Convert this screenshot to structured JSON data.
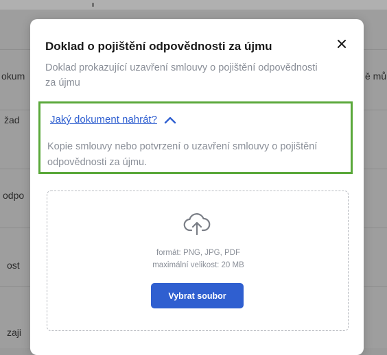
{
  "background": {
    "rows": [
      {
        "left": "okum",
        "right": "ě mů"
      },
      {
        "left": "žad"
      },
      {
        "left": "odpo"
      },
      {
        "left": "ost"
      },
      {
        "left": "zaji"
      }
    ]
  },
  "modal": {
    "title": "Doklad o pojištění odpovědnosti za újmu",
    "subtitle": "Doklad prokazující uzavření smlouvy o pojištění odpovědnosti za újmu",
    "close_icon": "close-icon",
    "help": {
      "link_label": "Jaký dokument nahrát?",
      "toggle_icon": "chevron-up-icon",
      "text": "Kopie smlouvy nebo potvrzení o uzavření smlouvy o pojištění odpovědnosti za újmu."
    },
    "upload": {
      "icon": "cloud-upload-icon",
      "format_text": "formát: PNG, JPG, PDF",
      "max_size_text": "maximální velikost: 20 MB",
      "button_label": "Vybrat soubor"
    }
  },
  "colors": {
    "accent": "#2f5fd0",
    "highlight_border": "#5aa83a",
    "muted_text": "#8a8f98",
    "overlay": "#9e9e9e"
  }
}
